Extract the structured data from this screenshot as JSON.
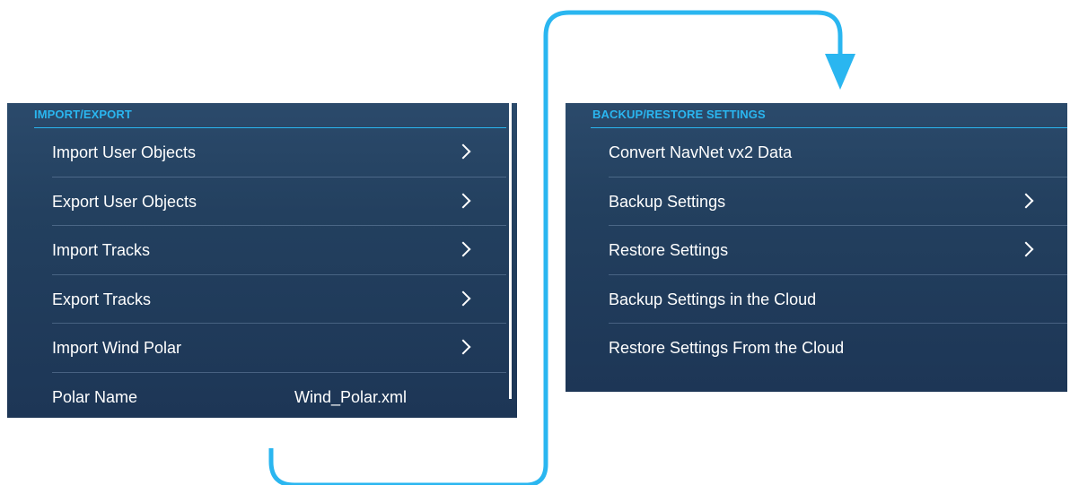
{
  "import_export": {
    "header": "IMPORT/EXPORT",
    "items": [
      {
        "label": "Import User Objects",
        "chevron": true
      },
      {
        "label": "Export User Objects",
        "chevron": true
      },
      {
        "label": "Import Tracks",
        "chevron": true
      },
      {
        "label": "Export Tracks",
        "chevron": true
      },
      {
        "label": "Import Wind Polar",
        "chevron": true
      },
      {
        "label": "Polar Name",
        "value": "Wind_Polar.xml",
        "chevron": false
      }
    ]
  },
  "backup_restore": {
    "header": "BACKUP/RESTORE SETTINGS",
    "items": [
      {
        "label": "Convert NavNet vx2 Data",
        "chevron": false
      },
      {
        "label": "Backup Settings",
        "chevron": true
      },
      {
        "label": "Restore Settings",
        "chevron": true
      },
      {
        "label": "Backup Settings in the Cloud",
        "chevron": false
      },
      {
        "label": "Restore Settings From the Cloud",
        "chevron": false
      }
    ]
  },
  "colors": {
    "accent": "#2ab6f0",
    "panel_background": "#23405f",
    "text": "#ffffff"
  },
  "icons": {
    "menu_item_arrow": "chevron-right-icon",
    "connector": "flow-arrow-icon"
  }
}
